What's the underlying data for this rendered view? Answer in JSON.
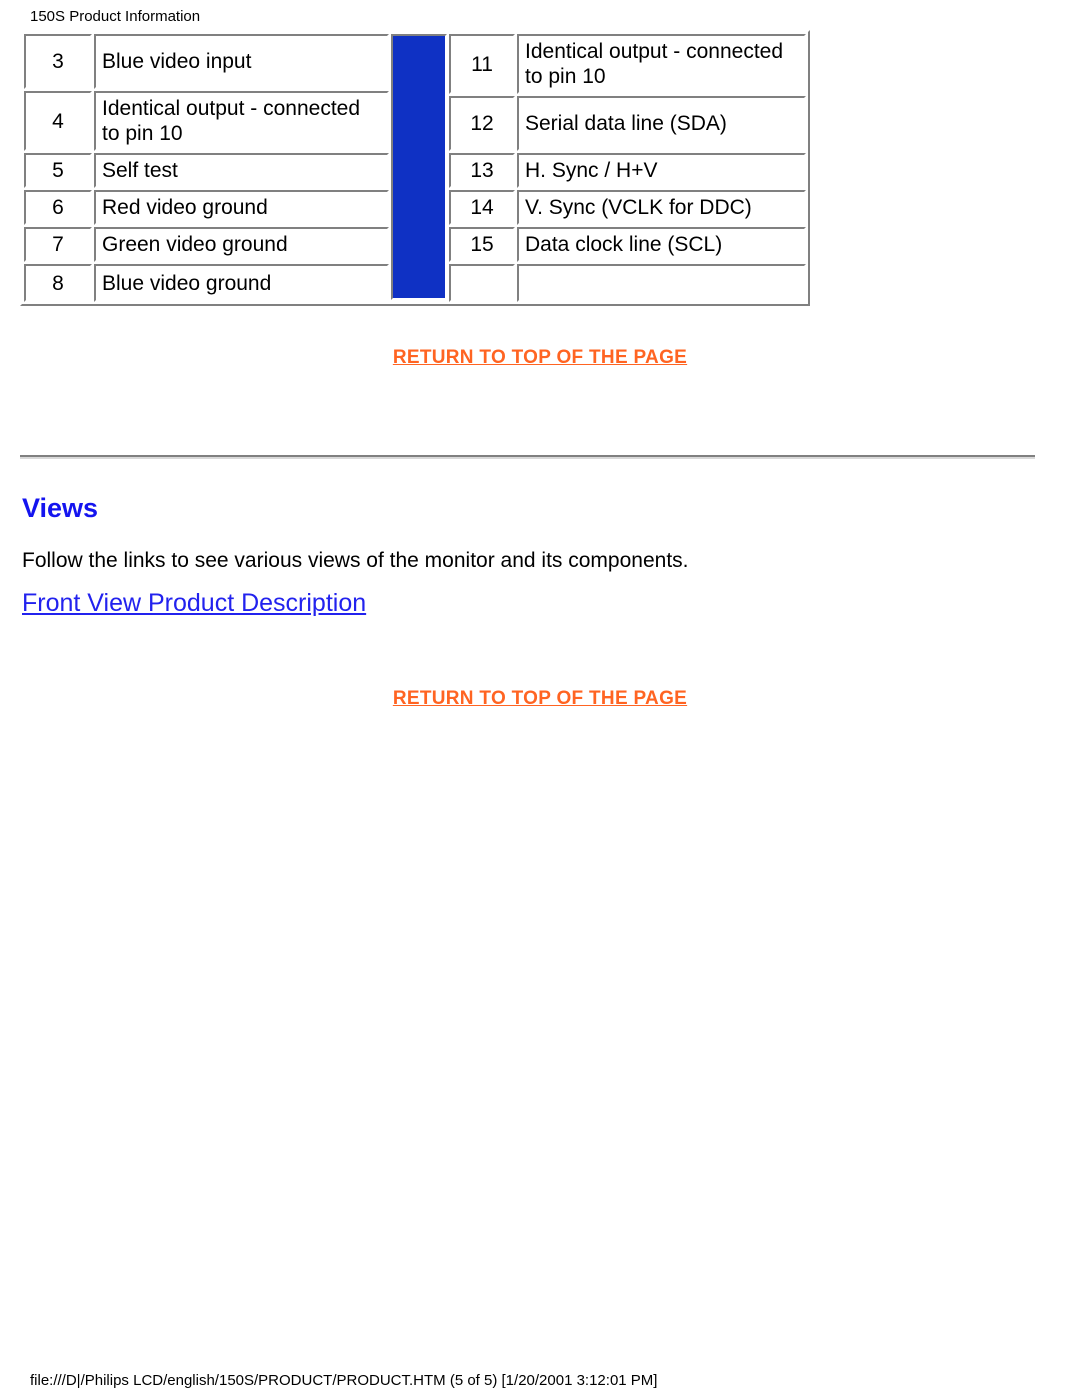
{
  "page": {
    "header_title": "150S Product Information",
    "footer_path": "file:///D|/Philips LCD/english/150S/PRODUCT/PRODUCT.HTM (5 of 5) [1/20/2001 3:12:01 PM]"
  },
  "colors": {
    "link_orange": "#ff6422",
    "link_blue": "#2222ee",
    "heading_blue": "#1414ef",
    "panel_blue": "#0f31c4",
    "border_gray": "#808080",
    "background": "#ffffff"
  },
  "pin_table": {
    "left_column": [
      {
        "pin": "3",
        "desc": "Blue video input",
        "lines": 1
      },
      {
        "pin": "4",
        "desc": "Identical output - connected to pin 10",
        "lines": 2
      },
      {
        "pin": "5",
        "desc": "Self test",
        "lines": 1
      },
      {
        "pin": "6",
        "desc": "Red video ground",
        "lines": 1
      },
      {
        "pin": "7",
        "desc": "Green video ground",
        "lines": 1
      },
      {
        "pin": "8",
        "desc": "Blue video ground",
        "lines": 1
      }
    ],
    "right_column": [
      {
        "pin": "11",
        "desc": "Identical output - connected to pin 10",
        "lines": 2
      },
      {
        "pin": "12",
        "desc": "Serial data line (SDA)",
        "lines": 1
      },
      {
        "pin": "13",
        "desc": "H. Sync / H+V",
        "lines": 1
      },
      {
        "pin": "14",
        "desc": "V. Sync (VCLK for DDC)",
        "lines": 1
      },
      {
        "pin": "15",
        "desc": "Data clock line (SCL)",
        "lines": 1
      },
      {
        "pin": "",
        "desc": "",
        "lines": 1
      }
    ]
  },
  "links": {
    "return_to_top_1": "RETURN TO TOP OF THE PAGE",
    "return_to_top_2": "RETURN TO TOP OF THE PAGE",
    "front_view": "Front View Product Description"
  },
  "views_section": {
    "heading": "Views",
    "paragraph": "Follow the links to see various views of the monitor and its components."
  }
}
